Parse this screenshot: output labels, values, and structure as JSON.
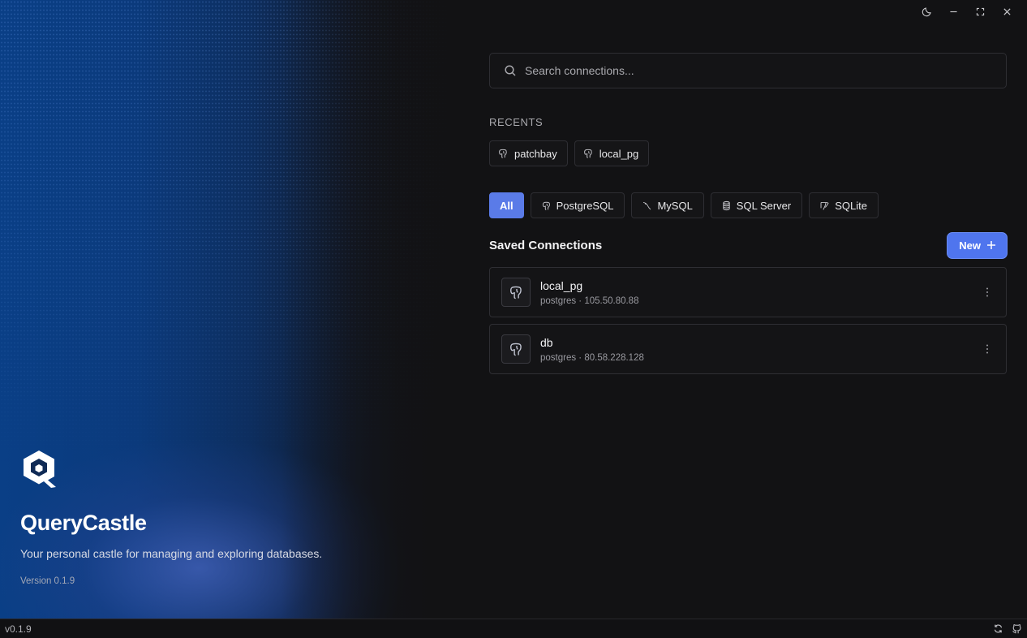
{
  "app": {
    "name": "QueryCastle",
    "tagline": "Your personal castle for managing and exploring databases.",
    "version_label": "Version 0.1.9",
    "logo_icon": "querycastle-logo-icon"
  },
  "window_controls": {
    "icons": [
      "moon-icon",
      "minimize-icon",
      "maximize-icon",
      "close-icon"
    ]
  },
  "search": {
    "placeholder": "Search connections...",
    "value": "",
    "icon": "search-icon"
  },
  "recents": {
    "label": "RECENTS",
    "items": [
      {
        "label": "patchbay",
        "icon": "postgres-elephant-icon"
      },
      {
        "label": "local_pg",
        "icon": "postgres-elephant-icon"
      }
    ]
  },
  "filters": {
    "items": [
      {
        "label": "All",
        "active": true
      },
      {
        "label": "PostgreSQL",
        "icon": "postgres-elephant-icon"
      },
      {
        "label": "MySQL",
        "icon": "mysql-dolphin-icon"
      },
      {
        "label": "SQL Server",
        "icon": "database-stack-icon"
      },
      {
        "label": "SQLite",
        "icon": "sqlite-feather-icon"
      }
    ]
  },
  "saved": {
    "title": "Saved Connections",
    "new_label": "New",
    "connections": [
      {
        "name": "local_pg",
        "detail": "postgres · 105.50.80.88",
        "icon": "postgres-elephant-icon"
      },
      {
        "name": "db",
        "detail": "postgres · 80.58.228.128",
        "icon": "postgres-elephant-icon"
      }
    ]
  },
  "statusbar": {
    "version": "v0.1.9",
    "icons": [
      "refresh-icon",
      "github-icon"
    ]
  },
  "colors": {
    "accent": "#4f75ee",
    "active_filter": "#5a7be8",
    "background": "#121214",
    "hero_blue": "#0a3f86"
  }
}
